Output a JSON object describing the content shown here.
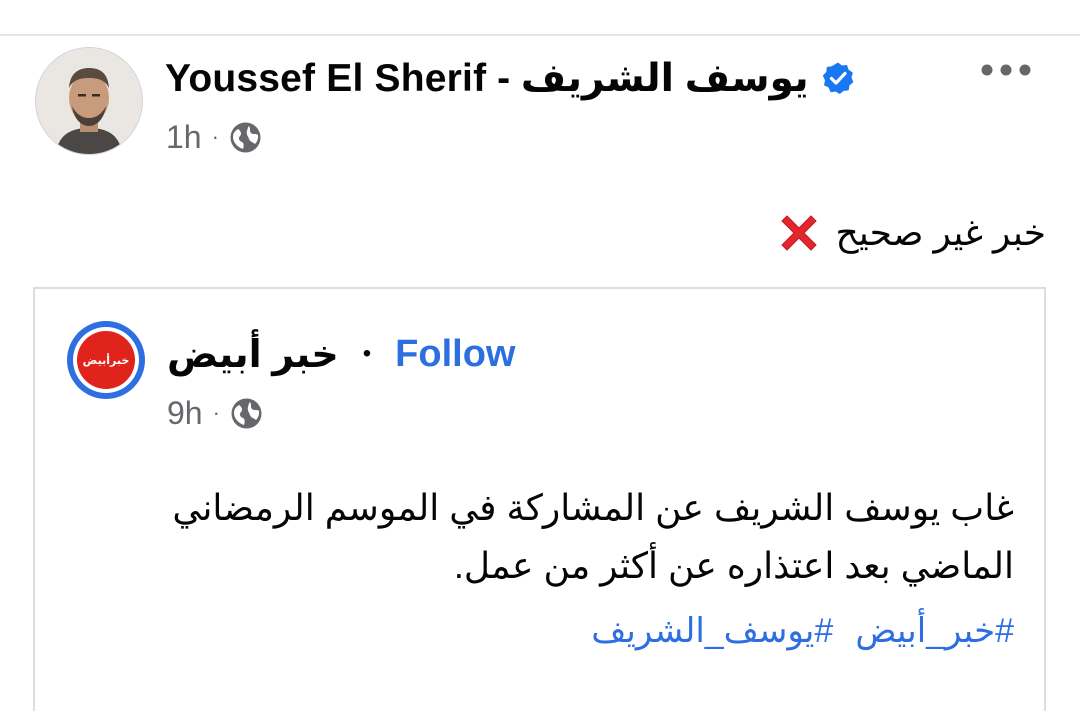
{
  "post": {
    "author_name": "يوسف الشريف - Youssef El Sherif",
    "verified": true,
    "time": "1h",
    "privacy_icon": "globe-icon",
    "more_icon": "more-horizontal-icon",
    "text": "خبر غير صحيح",
    "text_emoji_icon": "red-cross-mark-icon"
  },
  "shared_post": {
    "page_name": "خبر أبيض",
    "separator": "•",
    "follow_label": "Follow",
    "time": "9h",
    "privacy_icon": "globe-icon",
    "avatar_text": "خبرأبيض",
    "text": "غاب يوسف الشريف عن المشاركة في الموسم الرمضاني الماضي بعد اعتذاره عن أكثر من عمل.",
    "hashtags": [
      "#خبر_أبيض",
      "#يوسف_الشريف"
    ]
  },
  "colors": {
    "accent_blue": "#2d6fe0",
    "meta_gray": "#65676b",
    "avatar_red": "#e0241b",
    "cross_red": "#e1262d"
  }
}
